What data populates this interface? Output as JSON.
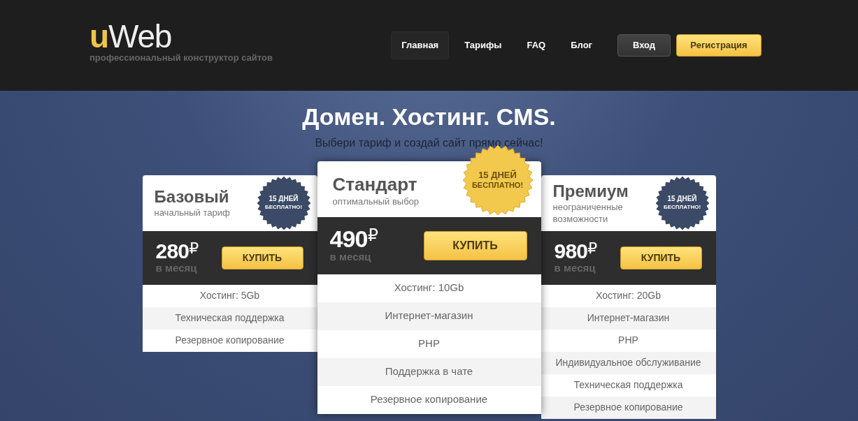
{
  "logo": {
    "accent": "u",
    "rest": "Web",
    "tagline": "профессиональный конструктор сайтов"
  },
  "nav": [
    {
      "label": "Главная",
      "selected": true
    },
    {
      "label": "Тарифы",
      "selected": false
    },
    {
      "label": "FAQ",
      "selected": false
    },
    {
      "label": "Блог",
      "selected": false
    }
  ],
  "login_button": "Вход",
  "register_button": "Регистрация",
  "hero": {
    "title": "Домен. Хостинг. CMS.",
    "subtitle": "Выбери тариф и создай сайт прямо сейчас!"
  },
  "plans": [
    {
      "name": "Базовый",
      "description": "начальный тариф",
      "featured": false,
      "seal": [
        "15 ДНЕЙ",
        "БЕСПЛАТНО!"
      ],
      "price": "280",
      "currency": "₽",
      "period": "в месяц",
      "buy": "КУПИТЬ",
      "features": [
        "Хостинг: 5Gb",
        "Техническая поддержка",
        "Резервное копирование"
      ]
    },
    {
      "name": "Стандарт",
      "description": "оптимальный выбор",
      "featured": true,
      "seal": [
        "15 ДНЕЙ",
        "БЕСПЛАТНО!"
      ],
      "price": "490",
      "currency": "₽",
      "period": "в месяц",
      "buy": "КУПИТЬ",
      "features": [
        "Хостинг: 10Gb",
        "Интернет-магазин",
        "PHP",
        "Поддержка в чате",
        "Резервное копирование"
      ]
    },
    {
      "name": "Премиум",
      "description": "неограниченные возможности",
      "featured": false,
      "seal": [
        "15 ДНЕЙ",
        "БЕСПЛАТНО!"
      ],
      "price": "980",
      "currency": "₽",
      "period": "в месяц",
      "buy": "КУПИТЬ",
      "features": [
        "Хостинг: 20Gb",
        "Интернет-магазин",
        "PHP",
        "Индивидуальное обслуживание",
        "Техническая поддержка",
        "Резервное копирование"
      ]
    }
  ]
}
